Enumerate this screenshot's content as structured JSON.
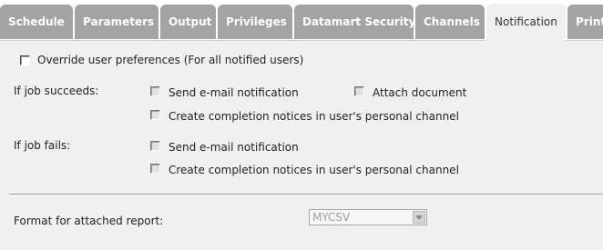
{
  "tabs": [
    {
      "label": "Schedule",
      "active": false
    },
    {
      "label": "Parameters",
      "active": false
    },
    {
      "label": "Output",
      "active": false
    },
    {
      "label": "Privileges",
      "active": false
    },
    {
      "label": "Datamart Security",
      "active": false
    },
    {
      "label": "Channels",
      "active": false
    },
    {
      "label": "Notification",
      "active": true
    },
    {
      "label": "Print",
      "active": false
    }
  ],
  "override": {
    "label": "Override user preferences (For all notified users)",
    "checked": false
  },
  "success": {
    "heading": "If job succeeds:",
    "email_label": "Send e-mail notification",
    "attach_label": "Attach document",
    "channel_label": "Create completion notices in user's personal channel"
  },
  "fail": {
    "heading": "If job fails:",
    "email_label": "Send e-mail notification",
    "channel_label": "Create completion notices in user's personal channel"
  },
  "format": {
    "label": "Format for attached report:",
    "value": "MYCSV"
  },
  "colors": {
    "tab_inactive": "#a3a3a3",
    "tab_active": "#f0f0f0",
    "panel": "#f0f0f0"
  }
}
